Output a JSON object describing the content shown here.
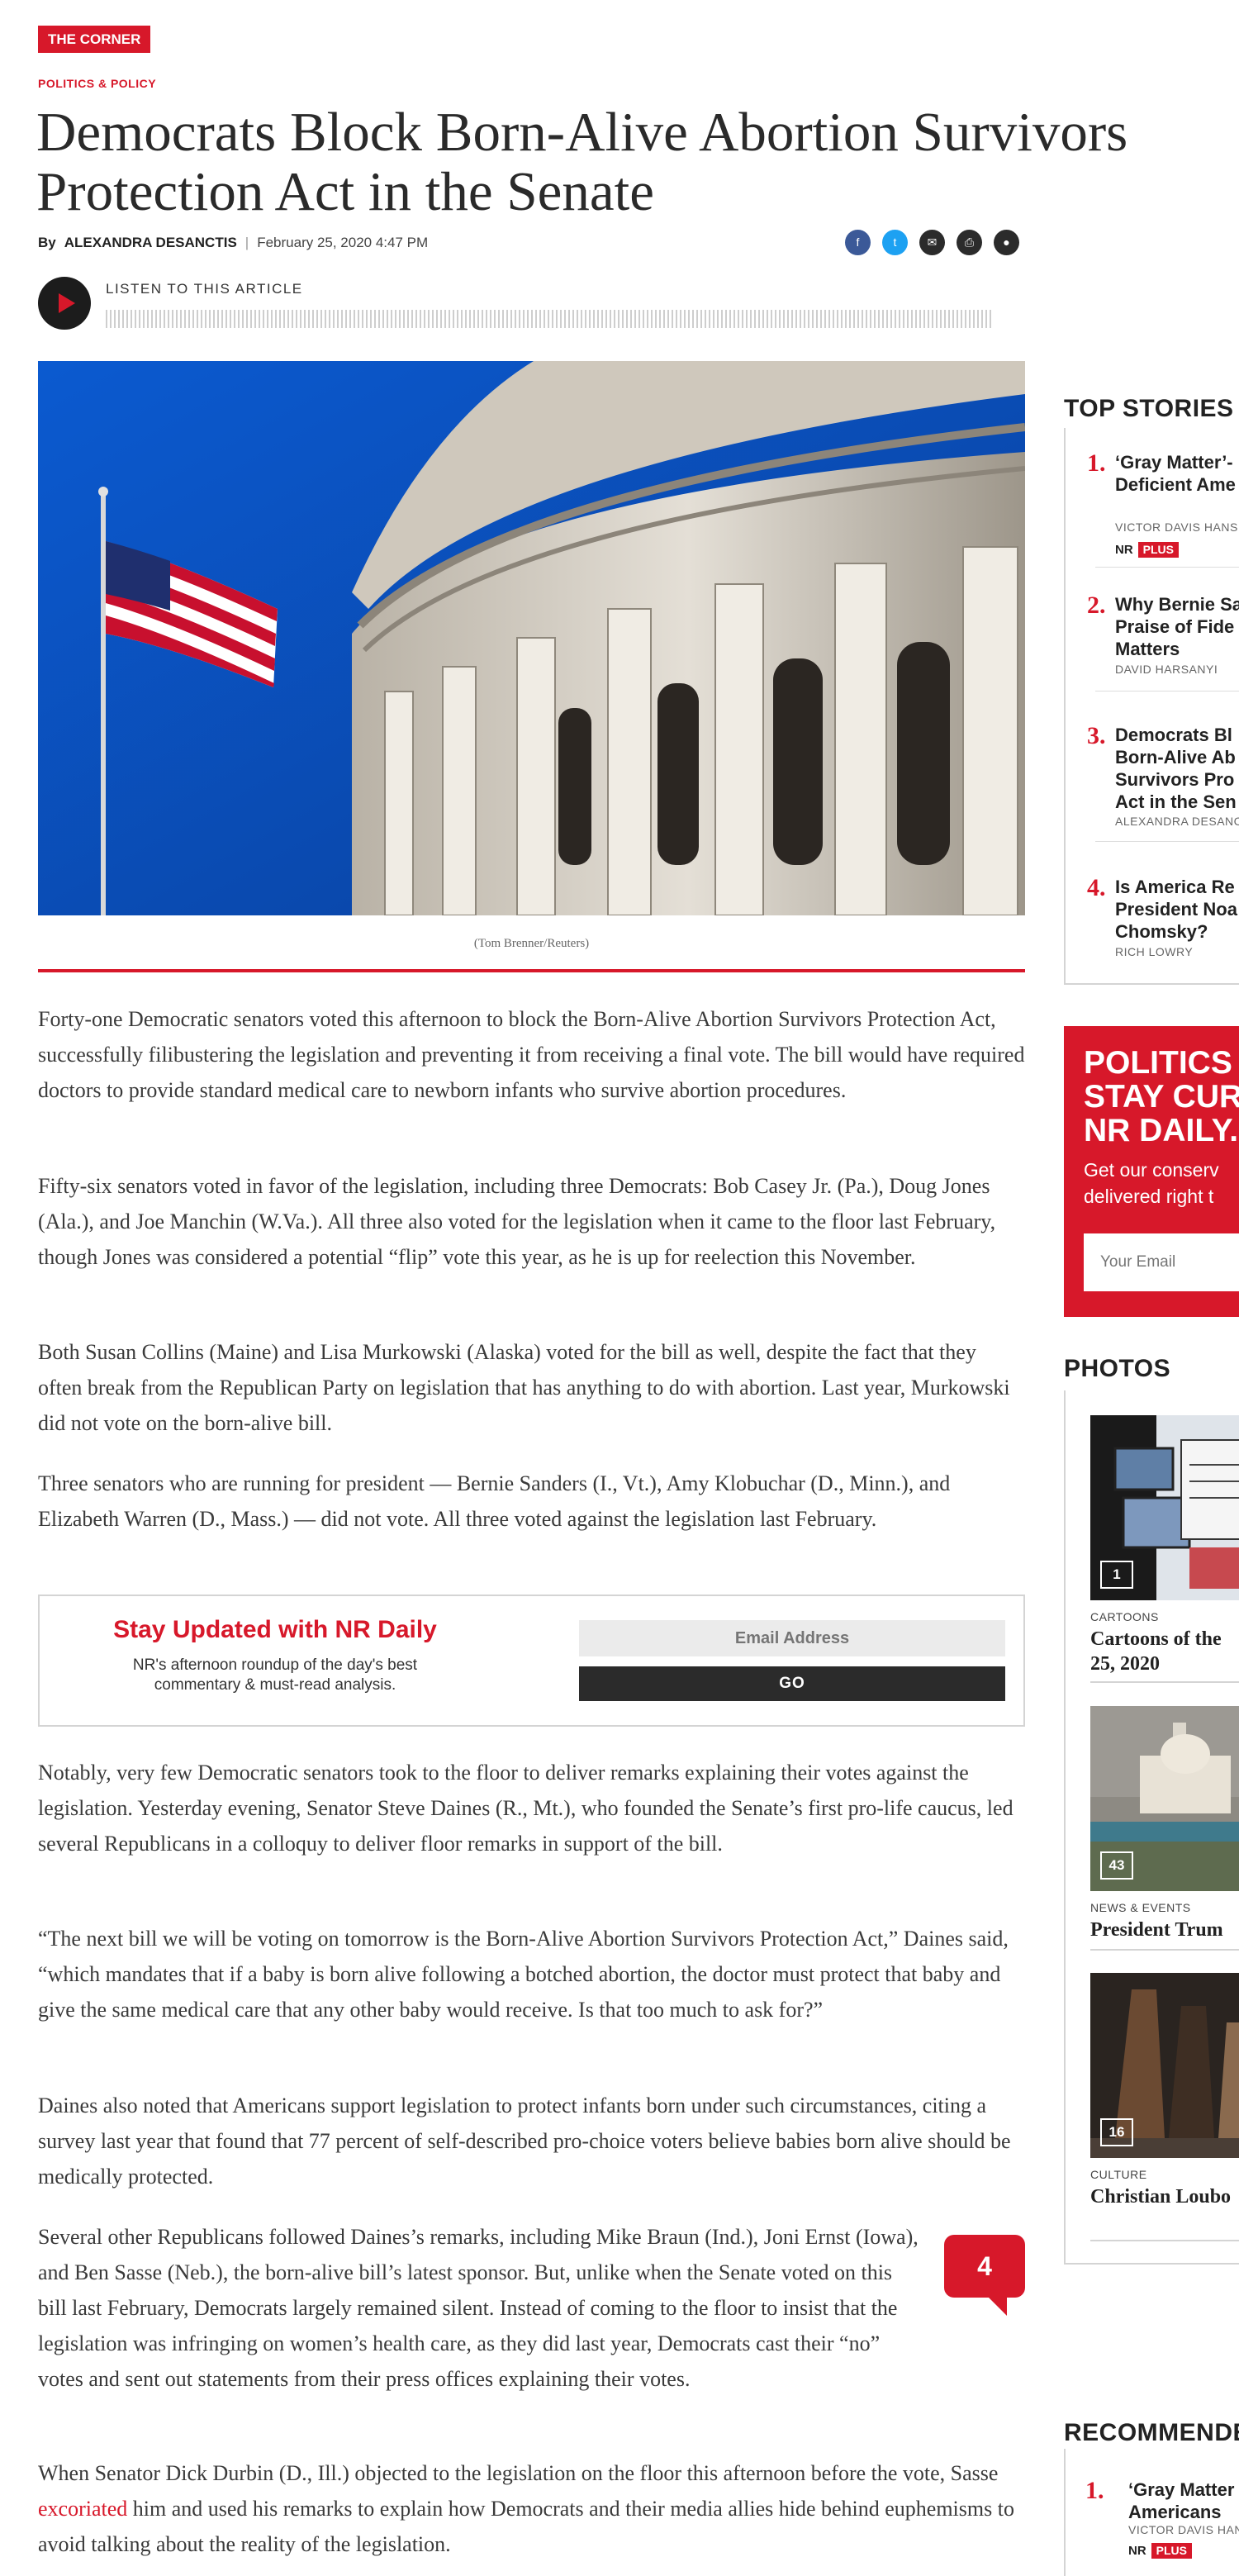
{
  "header": {
    "badge": "THE CORNER",
    "kicker": "POLITICS & POLICY",
    "headline": "Democrats Block Born-Alive Abortion Survivors Protection Act in the Senate",
    "by": "By",
    "author": "ALEXANDRA DESANCTIS",
    "date": "February 25, 2020 4:47 PM"
  },
  "share_icons": [
    "facebook-icon",
    "twitter-icon",
    "email-icon",
    "print-icon",
    "comment-icon"
  ],
  "audio": {
    "label": "LISTEN TO THIS ARTICLE"
  },
  "hero": {
    "caption": "(Tom Brenner/Reuters)"
  },
  "article": {
    "p1": "Forty-one Democratic senators voted this afternoon to block the Born-Alive Abortion Survivors Protection Act, successfully filibustering the legislation and preventing it from receiving a final vote. The bill would have required doctors to provide standard medical care to newborn infants who survive abortion procedures.",
    "p2": "Fifty-six senators voted in favor of the legislation, including three Democrats: Bob Casey Jr. (Pa.), Doug Jones (Ala.), and Joe Manchin (W.Va.). All three also voted for the legislation when it came to the floor last February, though Jones was considered a potential “flip” vote this year, as he is up for reelection this November.",
    "p3": "Both Susan Collins (Maine) and Lisa Murkowski (Alaska) voted for the bill as well, despite the fact that they often break from the Republican Party on legislation that has anything to do with abortion. Last year, Murkowski did not vote on the born-alive bill.",
    "p4": "Three senators who are running for president — Bernie Sanders (I., Vt.), Amy Klobuchar (D., Minn.), and Elizabeth Warren (D., Mass.) — did not vote. All three voted against the legislation last February.",
    "p5": "Notably, very few Democratic senators took to the floor to deliver remarks explaining their votes against the legislation. Yesterday evening, Senator Steve Daines (R., Mt.), who founded the Senate’s first pro-life caucus, led several Republicans in a colloquy to deliver floor remarks in support of the bill.",
    "p6": "“The next bill we will be voting on tomorrow is the Born-Alive Abortion Survivors Protection Act,” Daines said, “which mandates that if a baby is born alive following a botched abortion, the doctor must protect that baby and give the same medical care that any other baby would receive. Is that too much to ask for?”",
    "p7": "Daines also noted that Americans support legislation to protect infants born under such circumstances, citing a survey last year that found that 77 percent of self-described pro-choice voters believe babies born alive should be medically protected.",
    "p8": "Several other Republicans followed Daines’s remarks, including Mike Braun (Ind.), Joni Ernst (Iowa), and Ben Sasse (Neb.), the born-alive bill’s latest sponsor. But, unlike when the Senate voted on this bill last February, Democrats largely remained silent. Instead of coming to the floor to insist that the legislation was infringing on women’s health care, as they did last year, Democrats cast their “no” votes and sent out statements from their press offices explaining their votes.",
    "p9_before": "When Senator Dick Durbin (D., Ill.) objected to the legislation on the floor this afternoon before the vote, Sasse ",
    "p9_link": "excoriated",
    "p9_after": " him and used his remarks to explain how Democrats and their media allies hide behind euphemisms to avoid talking about the reality of the legislation."
  },
  "newsletter": {
    "title": "Stay Updated with NR Daily",
    "subtitle": "NR's afternoon roundup of the day's best commentary & must-read analysis.",
    "placeholder": "Email Address",
    "button": "GO"
  },
  "comments": {
    "count": "4"
  },
  "sidebar": {
    "top_stories": {
      "heading": "TOP STORIES",
      "items": [
        {
          "num": "1.",
          "title": "‘Gray Matter’-\nDeficient Ame",
          "author": "VICTOR DAVIS HANS",
          "nr": "NR",
          "plus": "PLUS"
        },
        {
          "num": "2.",
          "title": "Why Bernie Sa\nPraise of Fide\nMatters",
          "author": "DAVID HARSANYI"
        },
        {
          "num": "3.",
          "title": "Democrats Bl\nBorn-Alive Ab\nSurvivors Pro\nAct in the Sen",
          "author": "ALEXANDRA DESANC"
        },
        {
          "num": "4.",
          "title": "Is America Re\nPresident Noa\nChomsky?",
          "author": "RICH LOWRY"
        }
      ]
    },
    "promo": {
      "title": "POLITICS H\nSTAY CURR\nNR DAILY.",
      "subtitle": "Get our conserv\ndelivered right t",
      "placeholder": "Your Email"
    },
    "photos": {
      "heading": "PHOTOS",
      "items": [
        {
          "count": "1",
          "category": "CARTOONS",
          "title": "Cartoons of the\n25, 2020"
        },
        {
          "count": "43",
          "category": "NEWS & EVENTS",
          "title": "President Trum"
        },
        {
          "count": "16",
          "category": "CULTURE",
          "title": "Christian Loubo"
        }
      ]
    },
    "recommended": {
      "heading": "RECOMMENDE",
      "item": {
        "num": "1.",
        "title": "‘Gray Matter\nAmericans",
        "author": "VICTOR DAVIS HAN",
        "nr": "NR",
        "plus": "PLUS"
      }
    }
  },
  "colors": {
    "accent": "#d7182a",
    "text": "#3a3a3a"
  }
}
